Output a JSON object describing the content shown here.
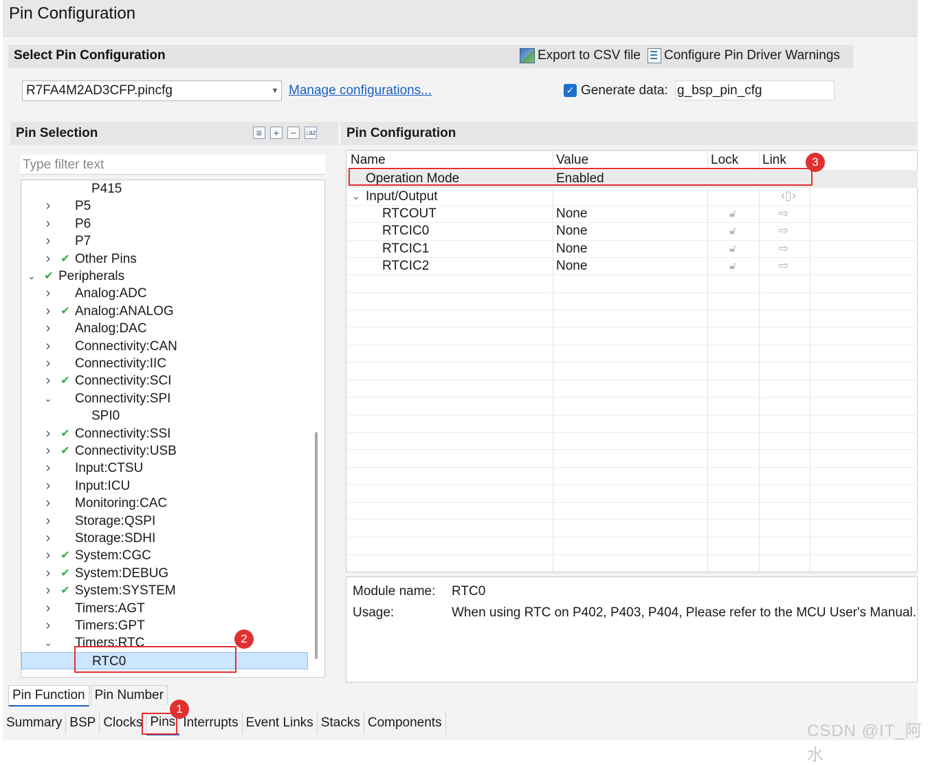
{
  "window": {
    "title": "Pin Configuration"
  },
  "select_config": {
    "title": "Select Pin Configuration",
    "export_label": "Export to CSV file",
    "warnings_label": "Configure Pin Driver Warnings",
    "combo_value": "R7FA4M2AD3CFP.pincfg",
    "manage_link": "Manage configurations...",
    "generate_label": "Generate data:",
    "generate_value": "g_bsp_pin_cfg"
  },
  "pin_selection": {
    "title": "Pin Selection",
    "filter_placeholder": "Type filter text",
    "tree": [
      {
        "label": "P415",
        "indent": 2,
        "chevron": "",
        "checked": false
      },
      {
        "label": "P5",
        "indent": 1,
        "chevron": "right",
        "checked": false
      },
      {
        "label": "P6",
        "indent": 1,
        "chevron": "right",
        "checked": false
      },
      {
        "label": "P7",
        "indent": 1,
        "chevron": "right",
        "checked": false
      },
      {
        "label": "Other Pins",
        "indent": 1,
        "chevron": "right",
        "checked": true
      },
      {
        "label": "Peripherals",
        "indent": 0,
        "chevron": "down",
        "checked": true
      },
      {
        "label": "Analog:ADC",
        "indent": 1,
        "chevron": "right",
        "checked": false
      },
      {
        "label": "Analog:ANALOG",
        "indent": 1,
        "chevron": "right",
        "checked": true
      },
      {
        "label": "Analog:DAC",
        "indent": 1,
        "chevron": "right",
        "checked": false
      },
      {
        "label": "Connectivity:CAN",
        "indent": 1,
        "chevron": "right",
        "checked": false
      },
      {
        "label": "Connectivity:IIC",
        "indent": 1,
        "chevron": "right",
        "checked": false
      },
      {
        "label": "Connectivity:SCI",
        "indent": 1,
        "chevron": "right",
        "checked": true
      },
      {
        "label": "Connectivity:SPI",
        "indent": 1,
        "chevron": "down",
        "checked": false
      },
      {
        "label": "SPI0",
        "indent": 2,
        "chevron": "",
        "checked": false
      },
      {
        "label": "Connectivity:SSI",
        "indent": 1,
        "chevron": "right",
        "checked": true
      },
      {
        "label": "Connectivity:USB",
        "indent": 1,
        "chevron": "right",
        "checked": true
      },
      {
        "label": "Input:CTSU",
        "indent": 1,
        "chevron": "right",
        "checked": false
      },
      {
        "label": "Input:ICU",
        "indent": 1,
        "chevron": "right",
        "checked": false
      },
      {
        "label": "Monitoring:CAC",
        "indent": 1,
        "chevron": "right",
        "checked": false
      },
      {
        "label": "Storage:QSPI",
        "indent": 1,
        "chevron": "right",
        "checked": false
      },
      {
        "label": "Storage:SDHI",
        "indent": 1,
        "chevron": "right",
        "checked": false
      },
      {
        "label": "System:CGC",
        "indent": 1,
        "chevron": "right",
        "checked": true
      },
      {
        "label": "System:DEBUG",
        "indent": 1,
        "chevron": "right",
        "checked": true
      },
      {
        "label": "System:SYSTEM",
        "indent": 1,
        "chevron": "right",
        "checked": true
      },
      {
        "label": "Timers:AGT",
        "indent": 1,
        "chevron": "right",
        "checked": false
      },
      {
        "label": "Timers:GPT",
        "indent": 1,
        "chevron": "right",
        "checked": false
      },
      {
        "label": "Timers:RTC",
        "indent": 1,
        "chevron": "down",
        "checked": false
      },
      {
        "label": "RTC0",
        "indent": 2,
        "chevron": "",
        "checked": false,
        "selected": true
      }
    ]
  },
  "pin_config": {
    "title": "Pin Configuration",
    "columns": [
      "Name",
      "Value",
      "Lock",
      "Link"
    ],
    "operation_mode": {
      "name": "Operation Mode",
      "value": "Enabled"
    },
    "group": "Input/Output",
    "pins": [
      {
        "name": "RTCOUT",
        "value": "None"
      },
      {
        "name": "RTCIC0",
        "value": "None"
      },
      {
        "name": "RTCIC1",
        "value": "None"
      },
      {
        "name": "RTCIC2",
        "value": "None"
      }
    ],
    "info": {
      "module_label": "Module name:",
      "module_value": "RTC0",
      "usage_label": "Usage:",
      "usage_value": "When using RTC on P402, P403, P404, Please refer to the MCU User's Manual."
    }
  },
  "mini_tabs": [
    "Pin Function",
    "Pin Number"
  ],
  "bottom_tabs": [
    "Summary",
    "BSP",
    "Clocks",
    "Pins",
    "Interrupts",
    "Event Links",
    "Stacks",
    "Components"
  ],
  "annotations": [
    "1",
    "2",
    "3"
  ],
  "watermark": "CSDN @IT_阿水",
  "colors": {
    "accent": "#1a5fc8",
    "annotation": "#e03030",
    "check": "#3aa84a",
    "selection": "#cce6ff"
  }
}
